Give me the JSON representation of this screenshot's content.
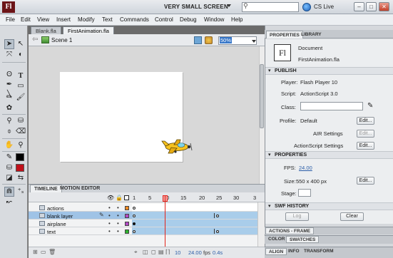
{
  "window": {
    "app_logo": "Fl",
    "workspace": "VERY SMALL SCREEN",
    "search_placeholder": "",
    "cs_live": "CS Live",
    "controls": {
      "minimize": "–",
      "maximize": "□",
      "close": "✕"
    }
  },
  "menu": [
    "File",
    "Edit",
    "View",
    "Insert",
    "Modify",
    "Text",
    "Commands",
    "Control",
    "Debug",
    "Window",
    "Help"
  ],
  "doc_tabs": [
    {
      "label": "Blank.fla",
      "active": false
    },
    {
      "label": "FirstAnimation.fla",
      "active": true
    }
  ],
  "editbar": {
    "scene": "Scene 1",
    "zoom": "50%"
  },
  "timeline": {
    "tabs": [
      "TIMELINE",
      "MOTION EDITOR"
    ],
    "frame_numbers": [
      "1",
      "5",
      "10",
      "15",
      "20",
      "25",
      "30",
      "3"
    ],
    "current_frame": 10,
    "layers": [
      {
        "name": "actions",
        "color": "#f08a24",
        "selected": false
      },
      {
        "name": "blank layer",
        "color": "#b149c4",
        "selected": true
      },
      {
        "name": "airplane",
        "color": "#b149c4",
        "selected": false
      },
      {
        "name": "text",
        "color": "#2fb52f",
        "selected": false
      }
    ],
    "footer": {
      "frame": "10",
      "fps": "24.00",
      "fps_unit": "fps",
      "time": "0.4s"
    }
  },
  "properties": {
    "tabs": [
      "PROPERTIES",
      "LIBRARY"
    ],
    "doc_type": "Document",
    "doc_name": "FirstAnimation.fla",
    "doc_icon": "Fl",
    "publish_header": "PUBLISH",
    "player_label": "Player:",
    "player_value": "Flash Player 10",
    "script_label": "Script:",
    "script_value": "ActionScript 3.0",
    "class_label": "Class:",
    "profile_label": "Profile:",
    "profile_value": "Default",
    "edit_label": "Edit...",
    "air_settings": "AIR Settings",
    "as_settings": "ActionScript Settings",
    "props_header": "PROPERTIES",
    "fps_label": "FPS:",
    "fps_value": "24.00",
    "size_label": "Size:",
    "size_value": "550 x 400 px",
    "stage_label": "Stage:",
    "swf_header": "SWF HISTORY",
    "log_label": "Log",
    "clear_label": "Clear"
  },
  "bottom_panels": {
    "row1": [
      "ACTIONS - FRAME"
    ],
    "row2": [
      "COLOR",
      "SWATCHES"
    ],
    "row3": [
      "ALIGN",
      "INFO",
      "TRANSFORM"
    ]
  },
  "colors": {
    "stroke": "#000000",
    "fill": "#c0101a",
    "playhead": "#e2231a",
    "stage": "#ffffff"
  }
}
